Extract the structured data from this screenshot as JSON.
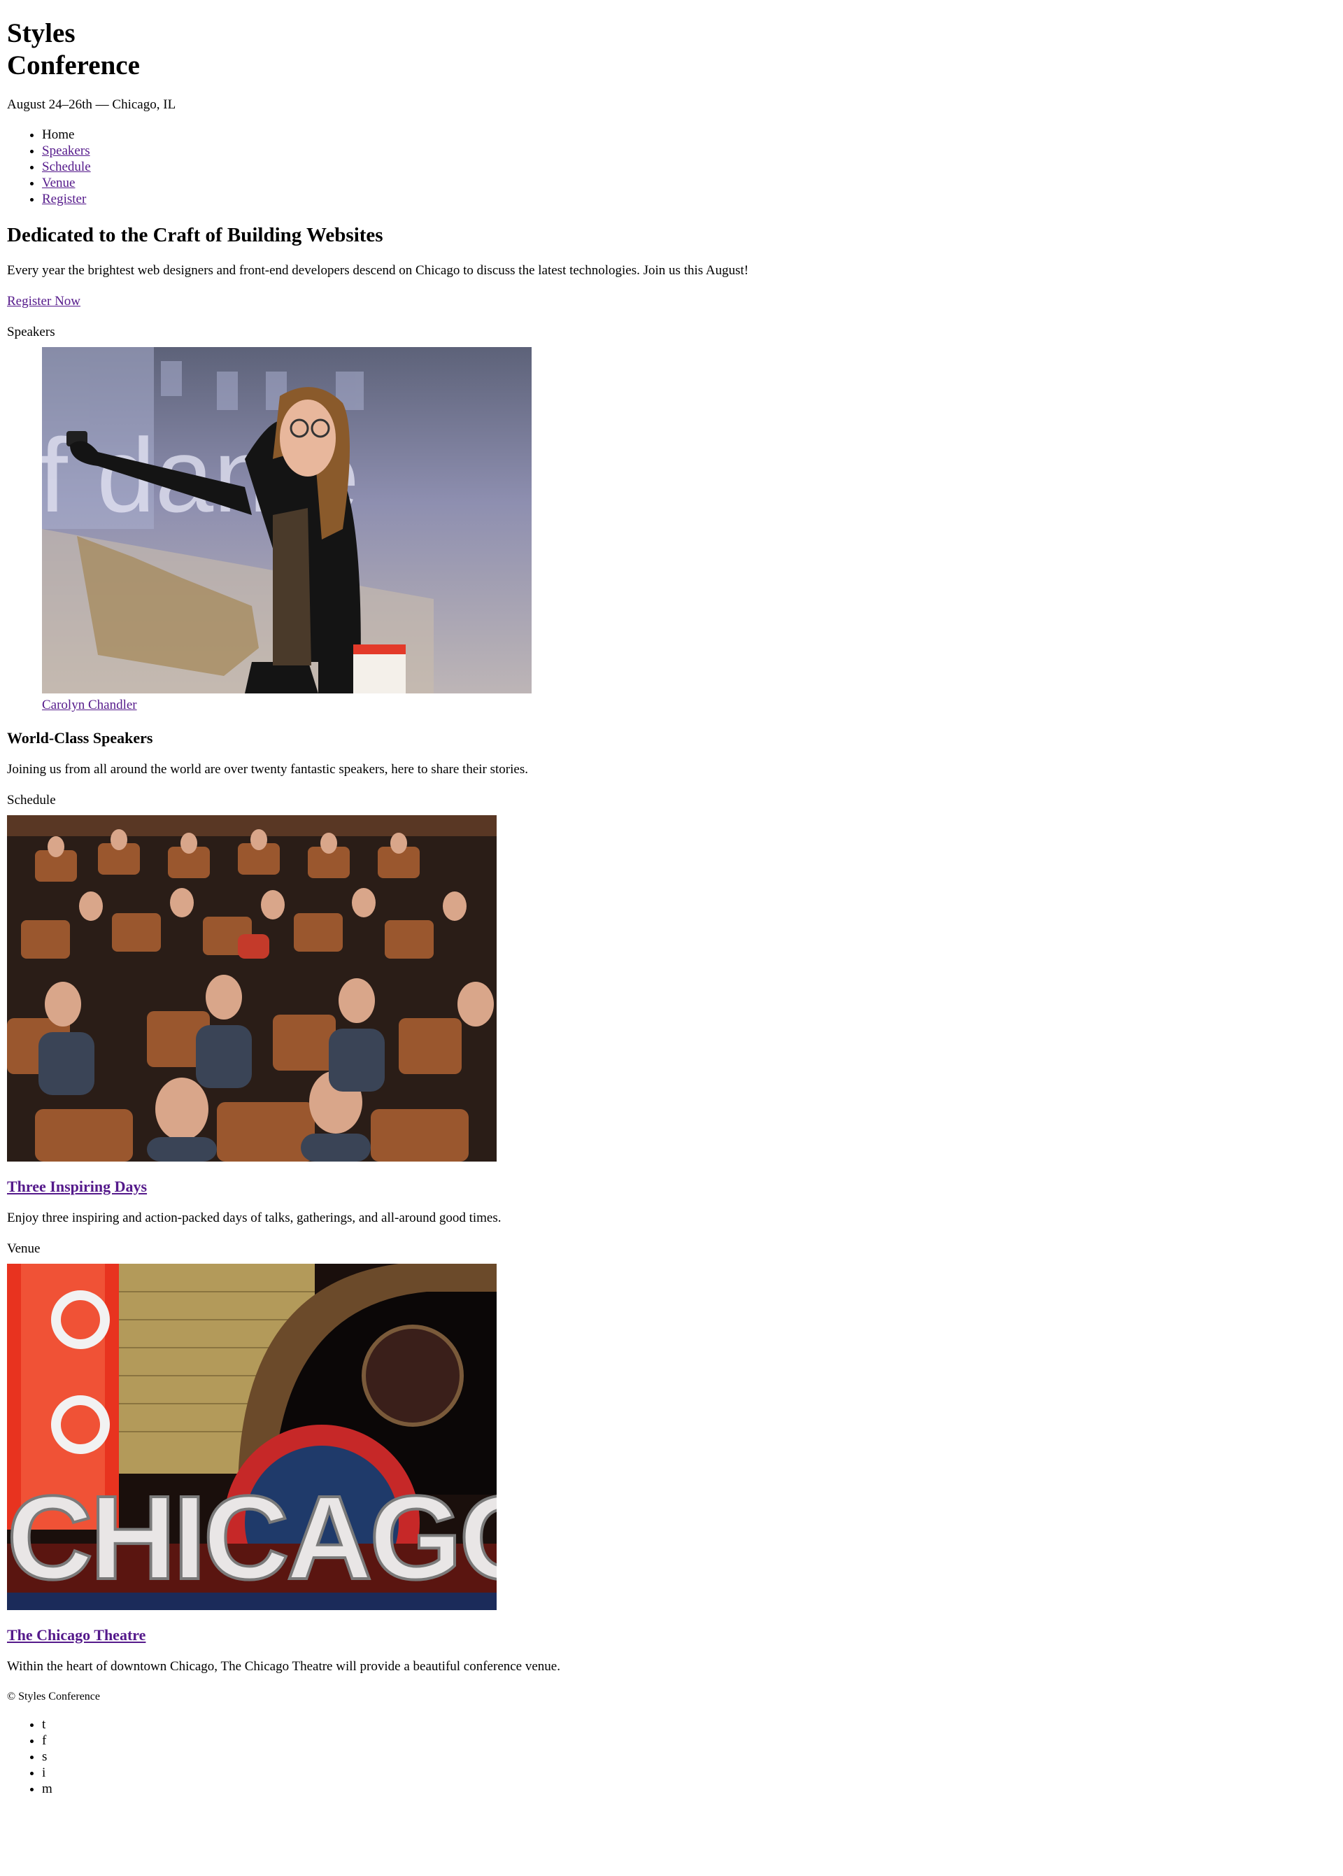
{
  "header": {
    "logo_line1": "Styles",
    "logo_line2": "Conference",
    "tagline": "August 24–26th — Chicago, IL",
    "nav": [
      "Home",
      "Speakers",
      "Schedule",
      "Venue",
      "Register"
    ]
  },
  "hero": {
    "title": "Dedicated to the Craft of Building Websites",
    "text": "Every year the brightest web designers and front-end developers descend on Chicago to discuss the latest technologies. Join us this August!",
    "cta": "Register Now"
  },
  "speakers": {
    "label": "Speakers",
    "caption": "Carolyn Chandler",
    "title": "World-Class Speakers",
    "text": "Joining us from all around the world are over twenty fantastic speakers, here to share their stories.",
    "photo_icon": "speaker-photo"
  },
  "schedule": {
    "label": "Schedule",
    "title": "Three Inspiring Days",
    "text": "Enjoy three inspiring and action-packed days of talks, gatherings, and all-around good times.",
    "photo_icon": "audience-photo"
  },
  "venue": {
    "label": "Venue",
    "title": "The Chicago Theatre",
    "text": "Within the heart of downtown Chicago, The Chicago Theatre will provide a beautiful conference venue.",
    "photo_icon": "theatre-sign-photo",
    "sign_text": "CHICAGO"
  },
  "footer": {
    "copyright": "© Styles Conference",
    "social": [
      "t",
      "f",
      "s",
      "i",
      "m"
    ]
  },
  "colors": {
    "link": "#551a8b",
    "text": "#000000",
    "background": "#ffffff"
  }
}
